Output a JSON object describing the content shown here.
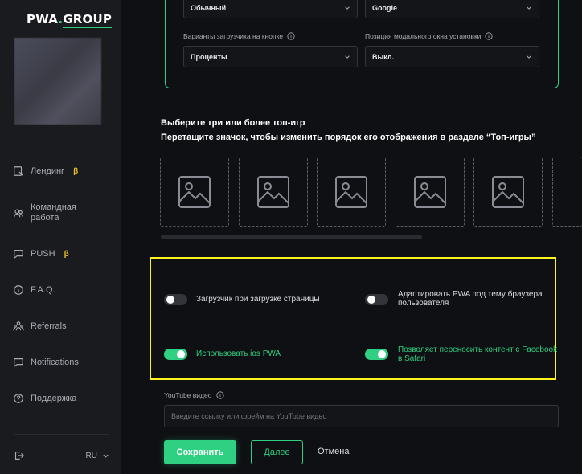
{
  "brand": {
    "logo_main": "PWA",
    "logo_dot": ".",
    "logo_suffix": "GROUP"
  },
  "sidebar": {
    "items": [
      {
        "label": "Лендинг",
        "badge": "β",
        "icon": "landing-icon"
      },
      {
        "label": "Командная работа",
        "icon": "team-icon"
      },
      {
        "label": "PUSH",
        "badge": "β",
        "icon": "chat-icon"
      },
      {
        "label": "F.A.Q.",
        "icon": "info-icon"
      },
      {
        "label": "Referrals",
        "icon": "referrals-icon"
      },
      {
        "label": "Notifications",
        "icon": "notifications-icon"
      },
      {
        "label": "Поддержка",
        "icon": "support-icon"
      }
    ],
    "language": "RU"
  },
  "settings": {
    "select_1": "Обычный",
    "select_2": "Google",
    "label_loader": "Варианты загрузчика на кнопке",
    "label_modal": "Позиция модального окна установки",
    "select_loader": "Проценты",
    "select_modal": "Выкл."
  },
  "top_games": {
    "title": "Выберите три или более топ-игр",
    "subtitle": "Перетащите значок, чтобы изменить порядок его отображения в разделе “Топ-игры”",
    "slot_count": 6
  },
  "toggles": [
    {
      "label": "Загрузчик при загрузке страницы",
      "on": false
    },
    {
      "label": "Адаптировать PWA под тему браузера пользователя",
      "on": false
    },
    {
      "label": "Использовать ios PWA",
      "on": true
    },
    {
      "label": "Позволяет переносить контент с Facebook в Safari",
      "on": true
    }
  ],
  "youtube": {
    "label": "YouTube видео",
    "placeholder": "Введите ссылку или фрейм на YouTube видео",
    "value": ""
  },
  "actions": {
    "save": "Сохранить",
    "next": "Далее",
    "cancel": "Отмена"
  },
  "colors": {
    "accent": "#2fd082",
    "highlight": "#fff41f",
    "beta": "#e8b923",
    "background": "#0f1013",
    "sidebar": "#1a1b1f"
  }
}
